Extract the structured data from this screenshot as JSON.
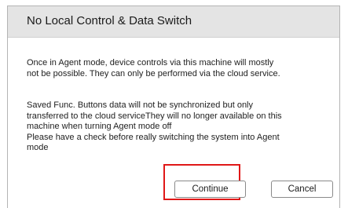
{
  "dialog": {
    "title": "No Local Control & Data Switch",
    "paragraph1": [
      "Once in Agent mode, device controls via this machine will mostly",
      "not be possible. They can only be performed via the cloud service."
    ],
    "paragraph2": [
      "Saved Func. Buttons data will not be synchronized but only",
      "transferred to the cloud serviceThey will no longer available on this",
      "machine when turning Agent mode off",
      "Please have a check before really switching the system into Agent",
      "mode"
    ],
    "buttons": {
      "continue_label": "Continue",
      "cancel_label": "Cancel"
    }
  },
  "colors": {
    "header_bg": "#e4e4e4",
    "highlight": "#e01818"
  }
}
